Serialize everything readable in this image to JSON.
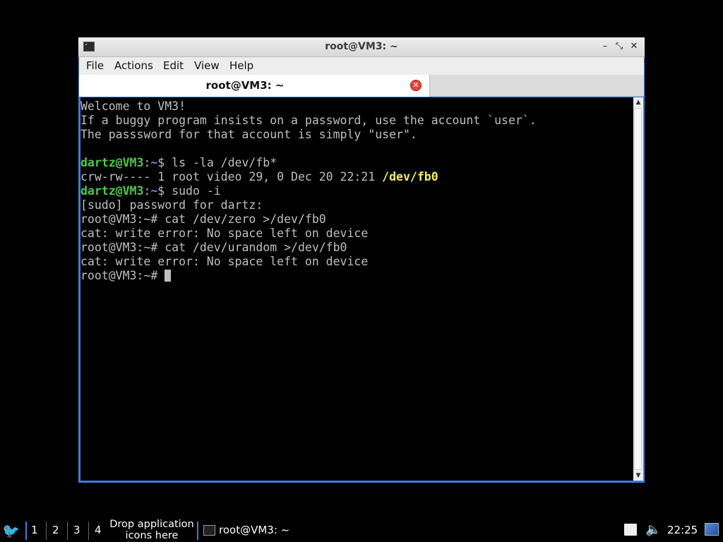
{
  "window": {
    "title": "root@VM3: ~",
    "minimize_glyph": "–",
    "maximize_glyph": "⤡",
    "close_glyph": "✕",
    "app_icon": "terminal-icon"
  },
  "menu": {
    "items": [
      {
        "label": "File"
      },
      {
        "label": "Actions"
      },
      {
        "label": "Edit"
      },
      {
        "label": "View"
      },
      {
        "label": "Help"
      }
    ]
  },
  "tab": {
    "label": "root@VM3: ~",
    "close_glyph": "✕",
    "close_icon": "tab-close-icon"
  },
  "terminal": {
    "lines": [
      [
        {
          "t": "Welcome to VM3!"
        }
      ],
      [
        {
          "t": "If a buggy program insists on a password, use the account `user`."
        }
      ],
      [
        {
          "t": "The passsword for that account is simply \"user\"."
        }
      ],
      [
        {
          "t": ""
        }
      ],
      [
        {
          "t": "dartz@VM3",
          "c": "u"
        },
        {
          "t": ":"
        },
        {
          "t": "~",
          "c": "p"
        },
        {
          "t": "$ ls -la /dev/fb*"
        }
      ],
      [
        {
          "t": "crw-rw---- 1 root video 29, 0 Dec 20 22:21 "
        },
        {
          "t": "/dev/fb0",
          "c": "y"
        }
      ],
      [
        {
          "t": "dartz@VM3",
          "c": "u"
        },
        {
          "t": ":"
        },
        {
          "t": "~",
          "c": "p"
        },
        {
          "t": "$ sudo -i"
        }
      ],
      [
        {
          "t": "[sudo] password for dartz:"
        }
      ],
      [
        {
          "t": "root@VM3:~# cat /dev/zero >/dev/fb0"
        }
      ],
      [
        {
          "t": "cat: write error: No space left on device"
        }
      ],
      [
        {
          "t": "root@VM3:~# cat /dev/urandom >/dev/fb0"
        }
      ],
      [
        {
          "t": "cat: write error: No space left on device"
        }
      ],
      [
        {
          "t": "root@VM3:~# "
        },
        {
          "cursor": true
        }
      ]
    ]
  },
  "scrollbar": {
    "up_glyph": "▲",
    "down_glyph": "▼"
  },
  "taskbar": {
    "start_glyph": "🐦",
    "workspaces": [
      "1",
      "2",
      "3",
      "4"
    ],
    "drop_hint": "Drop application icons here",
    "task_label": "root@VM3: ~",
    "volume_glyph": "🔈",
    "clock": "22:25"
  },
  "colors": {
    "window_frame": "#3b7ddd",
    "prompt_user": "#4ec94a",
    "prompt_path": "#5b8dff",
    "highlight_file": "#f4ef5a",
    "terminal_text": "#bfbfbf"
  }
}
